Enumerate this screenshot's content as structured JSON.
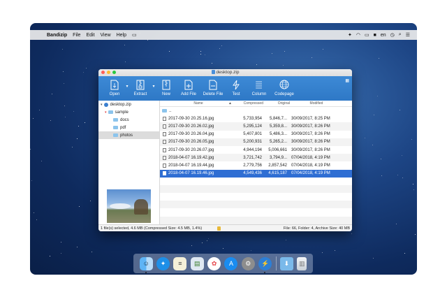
{
  "menubar": {
    "app_name": "Bandizip",
    "items": [
      "File",
      "Edit",
      "View",
      "Help"
    ],
    "input_source": "en"
  },
  "window": {
    "title": "desktop.zip"
  },
  "toolbar": {
    "buttons": [
      {
        "label": "Open",
        "icon": "open-icon"
      },
      {
        "label": "Extract",
        "icon": "extract-icon"
      },
      {
        "label": "New",
        "icon": "new-archive-icon"
      },
      {
        "label": "Add File",
        "icon": "add-file-icon"
      },
      {
        "label": "Delete File",
        "icon": "delete-file-icon"
      },
      {
        "label": "Test",
        "icon": "test-icon"
      },
      {
        "label": "Column",
        "icon": "column-icon"
      },
      {
        "label": "Codepage",
        "icon": "globe-icon"
      }
    ]
  },
  "tree": {
    "root": "desktop.zip",
    "items": [
      "sample",
      "docs",
      "pdf",
      "photos"
    ]
  },
  "list": {
    "headers": {
      "name": "Name",
      "compressed": "Compressed",
      "original": "Original",
      "modified": "Modified"
    },
    "updir": "..",
    "rows": [
      {
        "name": "2017-09-30 20.25.16.jpg",
        "compressed": "5,733,954",
        "original": "5,846,7...",
        "modified": "30/09/2017, 8:25 PM"
      },
      {
        "name": "2017-09-30 20.26.02.jpg",
        "compressed": "5,295,124",
        "original": "5,359,8...",
        "modified": "30/09/2017, 8:26 PM"
      },
      {
        "name": "2017-09-30 20.26.04.jpg",
        "compressed": "5,407,801",
        "original": "5,486,3...",
        "modified": "30/09/2017, 8:26 PM"
      },
      {
        "name": "2017-09-30 20.26.05.jpg",
        "compressed": "5,200,931",
        "original": "5,265,2...",
        "modified": "30/09/2017, 8:26 PM"
      },
      {
        "name": "2017-09-30 20.26.07.jpg",
        "compressed": "4,944,194",
        "original": "5,006,661",
        "modified": "30/09/2017, 8:26 PM"
      },
      {
        "name": "2018-04-07 16.19.42.jpg",
        "compressed": "3,721,742",
        "original": "3,794,9...",
        "modified": "07/04/2018, 4:19 PM"
      },
      {
        "name": "2018-04-07 16.19.44.jpg",
        "compressed": "2,779,756",
        "original": "2,857,542",
        "modified": "07/04/2018, 4:19 PM"
      },
      {
        "name": "2018-04-07 16.19.46.jpg",
        "compressed": "4,549,436",
        "original": "4,615,187",
        "modified": "07/04/2018, 4:19 PM"
      }
    ]
  },
  "status": {
    "left": "1 file(s) selected, 4.6 MB (Compressed Size: 4.5 MB, 1.4%)",
    "right": "File: 66, Folder: 4, Archive Size: 40 MB"
  },
  "colors": {
    "toolbar": "#2e78c6",
    "selection": "#2f6ed3"
  }
}
